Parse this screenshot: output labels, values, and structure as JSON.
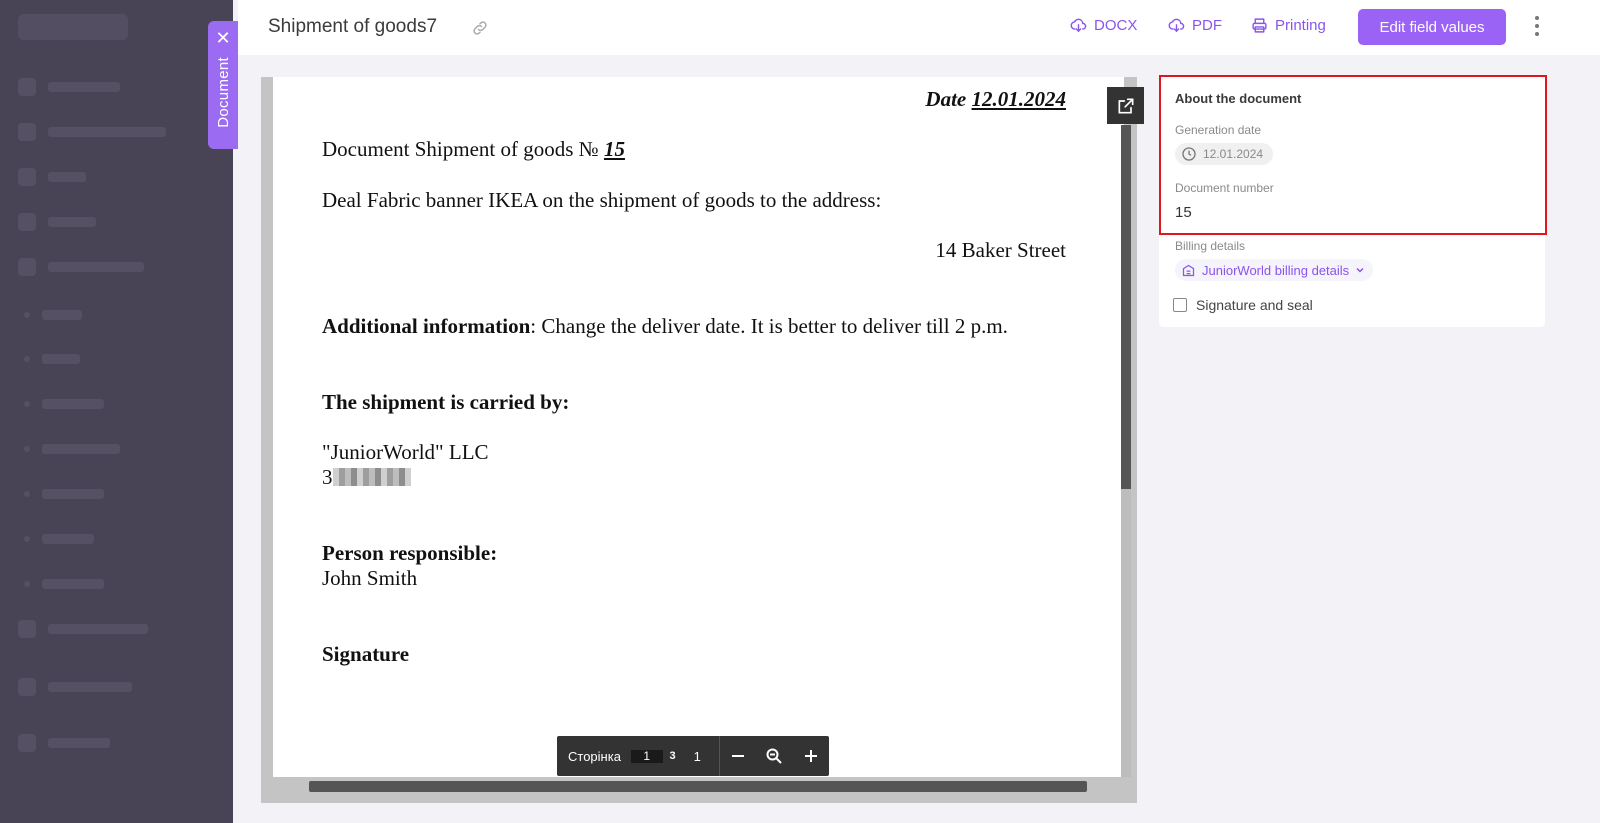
{
  "document_tab": {
    "label": "Document"
  },
  "header": {
    "title": "Shipment of goods7",
    "actions": {
      "docx": "DOCX",
      "pdf": "PDF",
      "printing": "Printing",
      "edit": "Edit field values"
    }
  },
  "document": {
    "date_label": "Date",
    "date_value": "12.01.2024",
    "heading_prefix": "Document Shipment of goods №",
    "heading_number": "15",
    "deal_line": "Deal Fabric banner IKEA  on the shipment of goods to the address:",
    "address": "14 Baker Street",
    "additional_label": "Additional information",
    "additional_text": ": Change the deliver date. It is better to deliver till 2 p.m.",
    "carrier_label": "The shipment is carried by:",
    "carrier_name": "\"JuniorWorld\" LLC",
    "carrier_detail_visible": "3",
    "responsible_label": "Person responsible:",
    "responsible_name": "John Smith",
    "signature_label": "Signature"
  },
  "pager": {
    "label": "Сторінка",
    "current": "1",
    "total": "3",
    "zoom": "1"
  },
  "about": {
    "title": "About the document",
    "generation_date_label": "Generation date",
    "generation_date": "12.01.2024",
    "document_number_label": "Document number",
    "document_number": "15",
    "billing_label": "Billing details",
    "billing_value": "JuniorWorld billing details",
    "signature_seal_label": "Signature and seal",
    "signature_seal_checked": false
  },
  "colors": {
    "accent": "#9b62f6",
    "highlight": "#e0161c",
    "sidebar": "#484355"
  }
}
